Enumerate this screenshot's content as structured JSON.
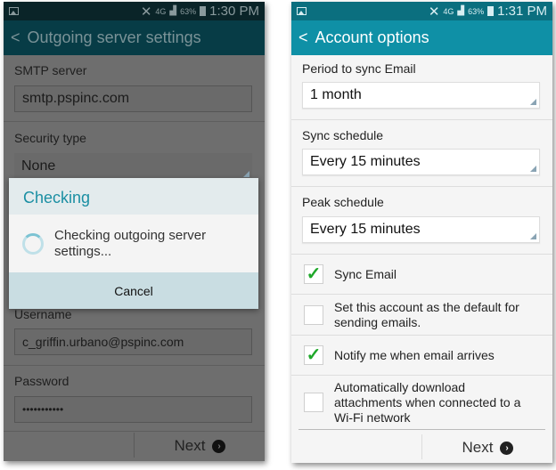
{
  "left": {
    "status": {
      "time": "1:30 PM",
      "battery": "63%",
      "network": "4G"
    },
    "title": "Outgoing server settings",
    "smtp_label": "SMTP server",
    "smtp_value": "smtp.pspinc.com",
    "security_label": "Security type",
    "security_value": "None",
    "username_label": "Username",
    "username_value": "c_griffin.urbano@pspinc.com",
    "password_label": "Password",
    "password_value": "•••••••••••",
    "next_label": "Next",
    "dialog": {
      "title": "Checking",
      "message": "Checking outgoing server settings...",
      "cancel_label": "Cancel"
    }
  },
  "right": {
    "status": {
      "time": "1:31 PM",
      "battery": "63%",
      "network": "4G"
    },
    "title": "Account options",
    "period_label": "Period to sync Email",
    "period_value": "1 month",
    "sync_label": "Sync schedule",
    "sync_value": "Every 15 minutes",
    "peak_label": "Peak schedule",
    "peak_value": "Every 15 minutes",
    "checkboxes": [
      {
        "label": "Sync Email",
        "checked": true
      },
      {
        "label": "Set this account as the default for sending emails.",
        "checked": false
      },
      {
        "label": "Notify me when email arrives",
        "checked": true
      },
      {
        "label": "Automatically download attachments when connected to a Wi-Fi network",
        "checked": false
      }
    ],
    "next_label": "Next"
  },
  "colors": {
    "header": "#0f90a6",
    "accent": "#1b8fa3",
    "check": "#1fa82a"
  }
}
